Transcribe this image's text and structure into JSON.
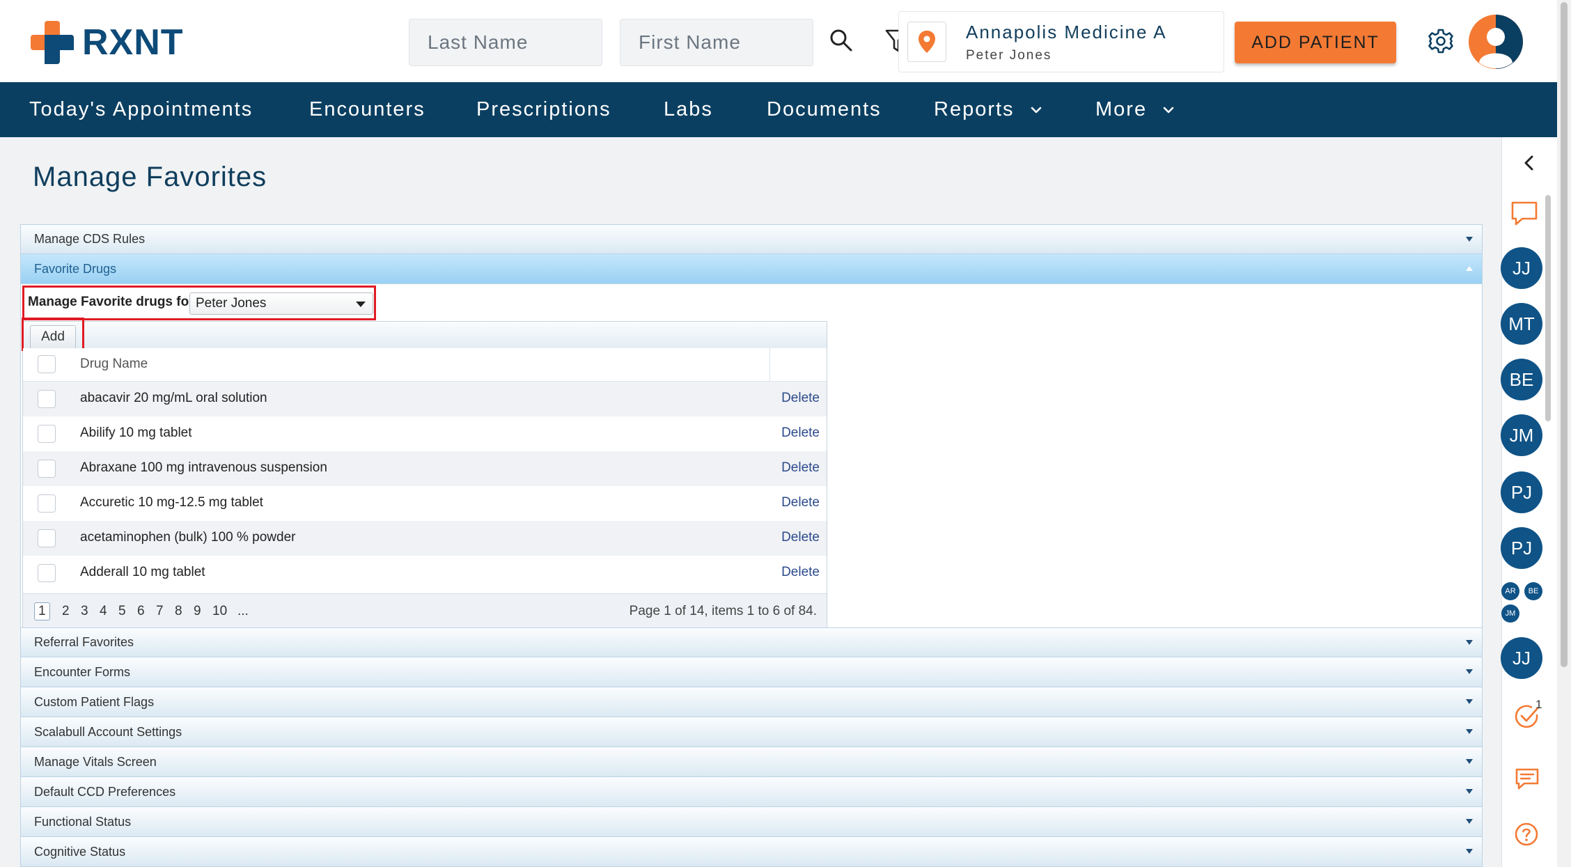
{
  "app": {
    "logo_text": "RXNT"
  },
  "header": {
    "last_name_placeholder": "Last Name",
    "first_name_placeholder": "First Name",
    "location_name": "Annapolis Medicine A",
    "location_user": "Peter Jones",
    "add_patient_label": "ADD PATIENT"
  },
  "nav": {
    "items": [
      {
        "label": "Today's Appointments"
      },
      {
        "label": "Encounters"
      },
      {
        "label": "Prescriptions"
      },
      {
        "label": "Labs"
      },
      {
        "label": "Documents"
      },
      {
        "label": "Reports"
      },
      {
        "label": "More"
      }
    ]
  },
  "page": {
    "title": "Manage Favorites"
  },
  "accordion": {
    "sections_above": [
      "Manage CDS Rules"
    ],
    "active_section": "Favorite Drugs",
    "sections_below": [
      "Referral Favorites",
      "Encounter Forms",
      "Custom Patient Flags",
      "Scalabull Account Settings",
      "Manage Vitals Screen",
      "Default CCD Preferences",
      "Functional Status",
      "Cognitive Status"
    ]
  },
  "favorites": {
    "manage_for_label": "Manage Favorite drugs for",
    "selected_provider": "Peter Jones",
    "add_label": "Add",
    "column_drug_name": "Drug Name",
    "delete_label": "Delete",
    "rows": [
      "abacavir 20 mg/mL oral solution",
      "Abilify 10 mg tablet",
      "Abraxane 100 mg intravenous suspension",
      "Accuretic 10 mg-12.5 mg tablet",
      "acetaminophen (bulk) 100 % powder",
      "Adderall 10 mg tablet"
    ],
    "pages": [
      "1",
      "2",
      "3",
      "4",
      "5",
      "6",
      "7",
      "8",
      "9",
      "10",
      "..."
    ],
    "current_page": "1",
    "pager_info": "Page 1 of 14, items 1 to 6 of 84."
  },
  "right_rail": {
    "avatars": [
      "JJ",
      "MT",
      "BE",
      "JM",
      "PJ",
      "PJ"
    ],
    "group_avatars": [
      "AR",
      "BE",
      "JM"
    ],
    "last_avatar": "JJ",
    "task_count": "1"
  },
  "colors": {
    "brand_orange": "#f47a34",
    "brand_navy": "#0b3f61",
    "avatar_blue": "#0f5387",
    "highlight_red": "#e01b24"
  }
}
